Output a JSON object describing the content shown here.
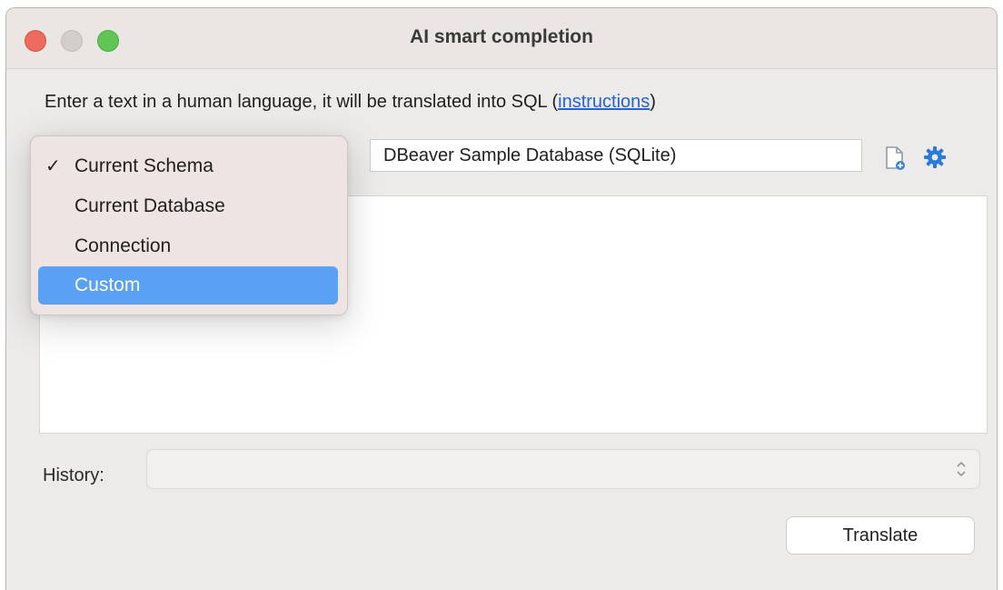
{
  "window": {
    "title": "AI smart completion"
  },
  "prompt": {
    "text_before": "Enter a text in a human language, it will be translated into SQL (",
    "link": "instructions",
    "text_after": ")"
  },
  "scope_dropdown": {
    "options": [
      {
        "label": "Current Schema",
        "checked": true,
        "highlighted": false
      },
      {
        "label": "Current Database",
        "checked": false,
        "highlighted": false
      },
      {
        "label": "Connection",
        "checked": false,
        "highlighted": false
      },
      {
        "label": "Custom",
        "checked": false,
        "highlighted": true
      }
    ],
    "check_glyph": "✓"
  },
  "database_field": {
    "value": "DBeaver Sample Database (SQLite)"
  },
  "icons": {
    "document": "document-icon",
    "settings": "gear-icon",
    "select_arrows": "up-down-chevron-icon"
  },
  "query": {
    "value": ""
  },
  "history": {
    "label": "History:",
    "value": ""
  },
  "actions": {
    "translate_label": "Translate"
  },
  "colors": {
    "accent": "#2e6fe0",
    "menu_highlight": "#5aa0f5",
    "link": "#2563d6",
    "close": "#ed6a5e",
    "maximize": "#61c554"
  }
}
